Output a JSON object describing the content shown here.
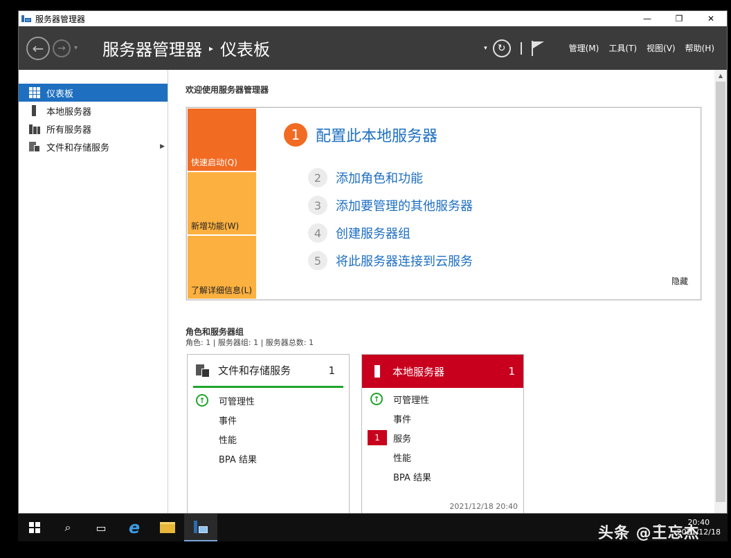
{
  "window": {
    "title": "服务器管理器",
    "minimize": "—",
    "restore": "❐",
    "close": "✕"
  },
  "header": {
    "back": "←",
    "forward": "→",
    "nav_dropdown": "▾",
    "breadcrumb_root": "服务器管理器",
    "breadcrumb_sep": "▸",
    "breadcrumb_current": "仪表板",
    "dropdown": "▾",
    "refresh": "↻",
    "menus": [
      "管理(M)",
      "工具(T)",
      "视图(V)",
      "帮助(H)"
    ]
  },
  "sidebar": {
    "items": [
      {
        "label": "仪表板",
        "icon": "dashboard-icon",
        "active": true
      },
      {
        "label": "本地服务器",
        "icon": "server-icon"
      },
      {
        "label": "所有服务器",
        "icon": "servers-icon"
      },
      {
        "label": "文件和存储服务",
        "icon": "file-storage-icon",
        "expand": "▶"
      }
    ]
  },
  "welcome": {
    "title": "欢迎使用服务器管理器",
    "tiles": [
      "快速启动(Q)",
      "新增功能(W)",
      "了解详细信息(L)"
    ],
    "main_step": {
      "num": "1",
      "label": "配置此本地服务器"
    },
    "steps": [
      {
        "num": "2",
        "label": "添加角色和功能"
      },
      {
        "num": "3",
        "label": "添加要管理的其他服务器"
      },
      {
        "num": "4",
        "label": "创建服务器组"
      },
      {
        "num": "5",
        "label": "将此服务器连接到云服务"
      }
    ],
    "hide": "隐藏"
  },
  "roles": {
    "title": "角色和服务器组",
    "subtitle": "角色: 1 | 服务器组: 1 | 服务器总数: 1",
    "cards": [
      {
        "title": "文件和存储服务",
        "count": "1",
        "rows": [
          {
            "label": "可管理性",
            "status": "ok"
          },
          {
            "label": "事件"
          },
          {
            "label": "性能"
          },
          {
            "label": "BPA 结果"
          }
        ]
      },
      {
        "title": "本地服务器",
        "count": "1",
        "rows": [
          {
            "label": "可管理性",
            "status": "ok"
          },
          {
            "label": "事件"
          },
          {
            "label": "服务",
            "alert": "1"
          },
          {
            "label": "性能"
          },
          {
            "label": "BPA 结果"
          }
        ],
        "timestamp": "2021/12/18 20:40"
      }
    ]
  },
  "taskbar": {
    "search": "⌕",
    "taskview": "▭",
    "ie": "e",
    "tray_chevron": "^",
    "time": "20:40",
    "date": "2021/12/18"
  },
  "watermark": "头条 @王忘杰",
  "colors": {
    "accent": "#1e6fc0",
    "orange": "#f26b23",
    "amber": "#fbb040",
    "red": "#c8001e",
    "green": "#1ea52a"
  }
}
